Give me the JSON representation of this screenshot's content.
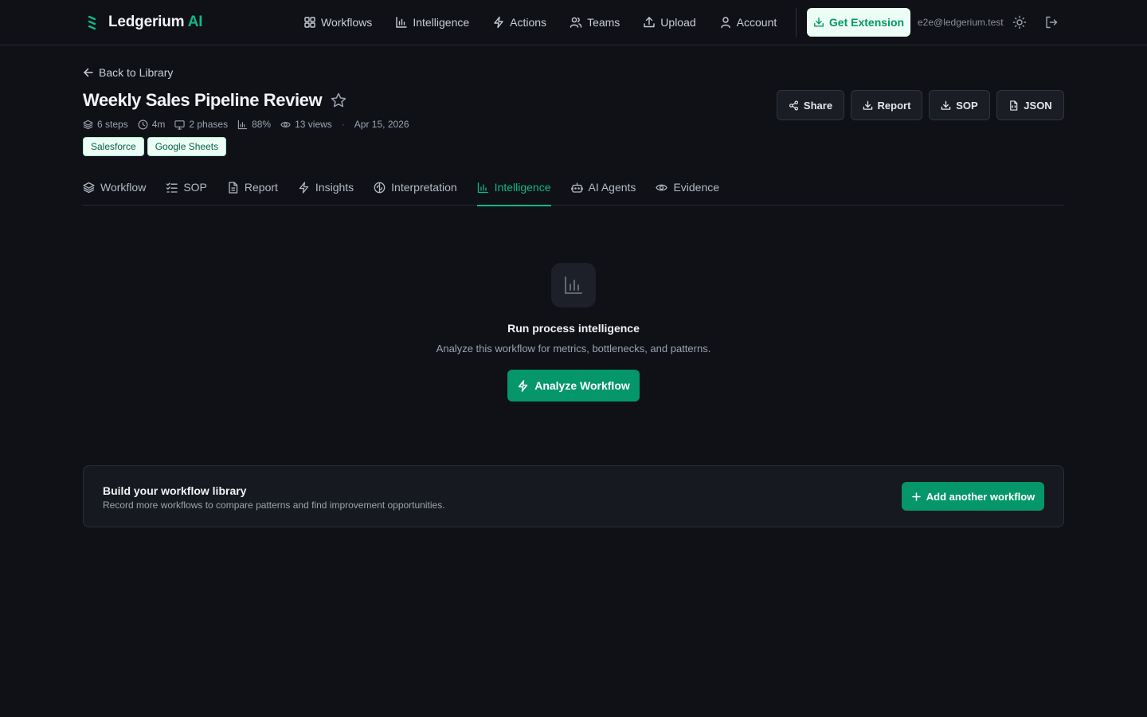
{
  "brand": {
    "name": "Ledgerium",
    "accent": "AI",
    "accent_color": "#10b981",
    "icon": "ledger-stack-icon"
  },
  "nav": {
    "items": [
      {
        "label": "Workflows",
        "icon": "grid-icon"
      },
      {
        "label": "Intelligence",
        "icon": "bar-chart-icon"
      },
      {
        "label": "Actions",
        "icon": "lightning-icon"
      },
      {
        "label": "Teams",
        "icon": "users-icon"
      },
      {
        "label": "Upload",
        "icon": "upload-icon"
      },
      {
        "label": "Account",
        "icon": "user-icon"
      }
    ],
    "extension_label": "Get Extension",
    "email": "e2e@ledgerium.test"
  },
  "header": {
    "back_label": "Back to Library",
    "title": "Weekly Sales Pipeline Review",
    "meta": {
      "steps": "6 steps",
      "duration": "4m",
      "phases": "2 phases",
      "score": "88%",
      "views": "13 views",
      "separator": "·",
      "date": "Apr 15, 2026"
    },
    "tags": [
      "Salesforce",
      "Google Sheets"
    ],
    "actions": {
      "share": "Share",
      "report": "Report",
      "sop": "SOP",
      "json": "JSON"
    }
  },
  "tabs": [
    {
      "label": "Workflow",
      "icon": "layers-icon"
    },
    {
      "label": "SOP",
      "icon": "checklist-icon"
    },
    {
      "label": "Report",
      "icon": "document-icon"
    },
    {
      "label": "Insights",
      "icon": "lightning-icon"
    },
    {
      "label": "Interpretation",
      "icon": "brain-icon"
    },
    {
      "label": "Intelligence",
      "icon": "bar-chart-icon",
      "active": true
    },
    {
      "label": "AI Agents",
      "icon": "robot-icon"
    },
    {
      "label": "Evidence",
      "icon": "eye-icon"
    }
  ],
  "empty_state": {
    "icon": "bar-chart-icon",
    "title": "Run process intelligence",
    "description": "Analyze this workflow for metrics, bottlenecks, and patterns.",
    "button_label": "Analyze Workflow"
  },
  "library_card": {
    "title": "Build your workflow library",
    "description": "Record more workflows to compare patterns and find improvement opportunities.",
    "button_label": "Add another workflow"
  },
  "colors": {
    "background": "#0f1117",
    "accent": "#10b981",
    "primary_button": "#059669"
  }
}
